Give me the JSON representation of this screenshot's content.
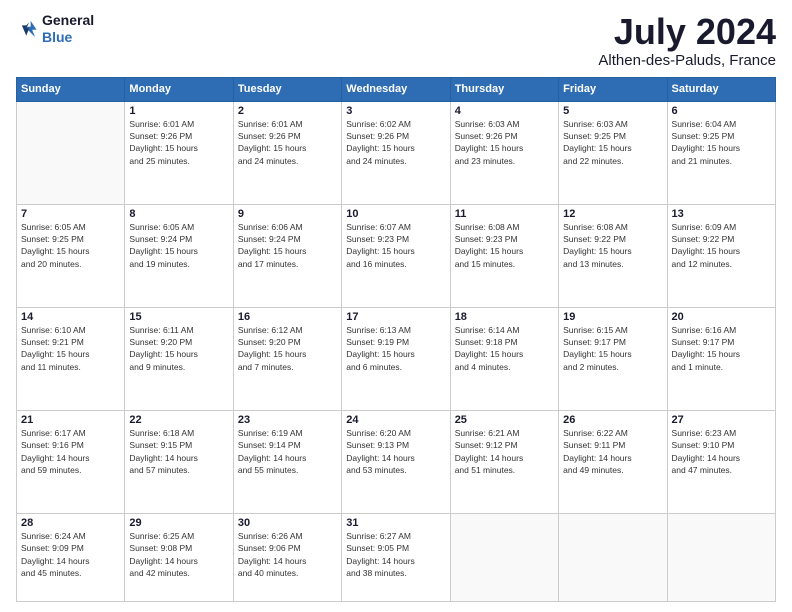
{
  "logo": {
    "line1": "General",
    "line2": "Blue"
  },
  "title": "July 2024",
  "location": "Althen-des-Paluds, France",
  "header": {
    "days": [
      "Sunday",
      "Monday",
      "Tuesday",
      "Wednesday",
      "Thursday",
      "Friday",
      "Saturday"
    ]
  },
  "weeks": [
    [
      {
        "day": "",
        "info": ""
      },
      {
        "day": "1",
        "info": "Sunrise: 6:01 AM\nSunset: 9:26 PM\nDaylight: 15 hours\nand 25 minutes."
      },
      {
        "day": "2",
        "info": "Sunrise: 6:01 AM\nSunset: 9:26 PM\nDaylight: 15 hours\nand 24 minutes."
      },
      {
        "day": "3",
        "info": "Sunrise: 6:02 AM\nSunset: 9:26 PM\nDaylight: 15 hours\nand 24 minutes."
      },
      {
        "day": "4",
        "info": "Sunrise: 6:03 AM\nSunset: 9:26 PM\nDaylight: 15 hours\nand 23 minutes."
      },
      {
        "day": "5",
        "info": "Sunrise: 6:03 AM\nSunset: 9:25 PM\nDaylight: 15 hours\nand 22 minutes."
      },
      {
        "day": "6",
        "info": "Sunrise: 6:04 AM\nSunset: 9:25 PM\nDaylight: 15 hours\nand 21 minutes."
      }
    ],
    [
      {
        "day": "7",
        "info": "Sunrise: 6:05 AM\nSunset: 9:25 PM\nDaylight: 15 hours\nand 20 minutes."
      },
      {
        "day": "8",
        "info": "Sunrise: 6:05 AM\nSunset: 9:24 PM\nDaylight: 15 hours\nand 19 minutes."
      },
      {
        "day": "9",
        "info": "Sunrise: 6:06 AM\nSunset: 9:24 PM\nDaylight: 15 hours\nand 17 minutes."
      },
      {
        "day": "10",
        "info": "Sunrise: 6:07 AM\nSunset: 9:23 PM\nDaylight: 15 hours\nand 16 minutes."
      },
      {
        "day": "11",
        "info": "Sunrise: 6:08 AM\nSunset: 9:23 PM\nDaylight: 15 hours\nand 15 minutes."
      },
      {
        "day": "12",
        "info": "Sunrise: 6:08 AM\nSunset: 9:22 PM\nDaylight: 15 hours\nand 13 minutes."
      },
      {
        "day": "13",
        "info": "Sunrise: 6:09 AM\nSunset: 9:22 PM\nDaylight: 15 hours\nand 12 minutes."
      }
    ],
    [
      {
        "day": "14",
        "info": "Sunrise: 6:10 AM\nSunset: 9:21 PM\nDaylight: 15 hours\nand 11 minutes."
      },
      {
        "day": "15",
        "info": "Sunrise: 6:11 AM\nSunset: 9:20 PM\nDaylight: 15 hours\nand 9 minutes."
      },
      {
        "day": "16",
        "info": "Sunrise: 6:12 AM\nSunset: 9:20 PM\nDaylight: 15 hours\nand 7 minutes."
      },
      {
        "day": "17",
        "info": "Sunrise: 6:13 AM\nSunset: 9:19 PM\nDaylight: 15 hours\nand 6 minutes."
      },
      {
        "day": "18",
        "info": "Sunrise: 6:14 AM\nSunset: 9:18 PM\nDaylight: 15 hours\nand 4 minutes."
      },
      {
        "day": "19",
        "info": "Sunrise: 6:15 AM\nSunset: 9:17 PM\nDaylight: 15 hours\nand 2 minutes."
      },
      {
        "day": "20",
        "info": "Sunrise: 6:16 AM\nSunset: 9:17 PM\nDaylight: 15 hours\nand 1 minute."
      }
    ],
    [
      {
        "day": "21",
        "info": "Sunrise: 6:17 AM\nSunset: 9:16 PM\nDaylight: 14 hours\nand 59 minutes."
      },
      {
        "day": "22",
        "info": "Sunrise: 6:18 AM\nSunset: 9:15 PM\nDaylight: 14 hours\nand 57 minutes."
      },
      {
        "day": "23",
        "info": "Sunrise: 6:19 AM\nSunset: 9:14 PM\nDaylight: 14 hours\nand 55 minutes."
      },
      {
        "day": "24",
        "info": "Sunrise: 6:20 AM\nSunset: 9:13 PM\nDaylight: 14 hours\nand 53 minutes."
      },
      {
        "day": "25",
        "info": "Sunrise: 6:21 AM\nSunset: 9:12 PM\nDaylight: 14 hours\nand 51 minutes."
      },
      {
        "day": "26",
        "info": "Sunrise: 6:22 AM\nSunset: 9:11 PM\nDaylight: 14 hours\nand 49 minutes."
      },
      {
        "day": "27",
        "info": "Sunrise: 6:23 AM\nSunset: 9:10 PM\nDaylight: 14 hours\nand 47 minutes."
      }
    ],
    [
      {
        "day": "28",
        "info": "Sunrise: 6:24 AM\nSunset: 9:09 PM\nDaylight: 14 hours\nand 45 minutes."
      },
      {
        "day": "29",
        "info": "Sunrise: 6:25 AM\nSunset: 9:08 PM\nDaylight: 14 hours\nand 42 minutes."
      },
      {
        "day": "30",
        "info": "Sunrise: 6:26 AM\nSunset: 9:06 PM\nDaylight: 14 hours\nand 40 minutes."
      },
      {
        "day": "31",
        "info": "Sunrise: 6:27 AM\nSunset: 9:05 PM\nDaylight: 14 hours\nand 38 minutes."
      },
      {
        "day": "",
        "info": ""
      },
      {
        "day": "",
        "info": ""
      },
      {
        "day": "",
        "info": ""
      }
    ]
  ]
}
